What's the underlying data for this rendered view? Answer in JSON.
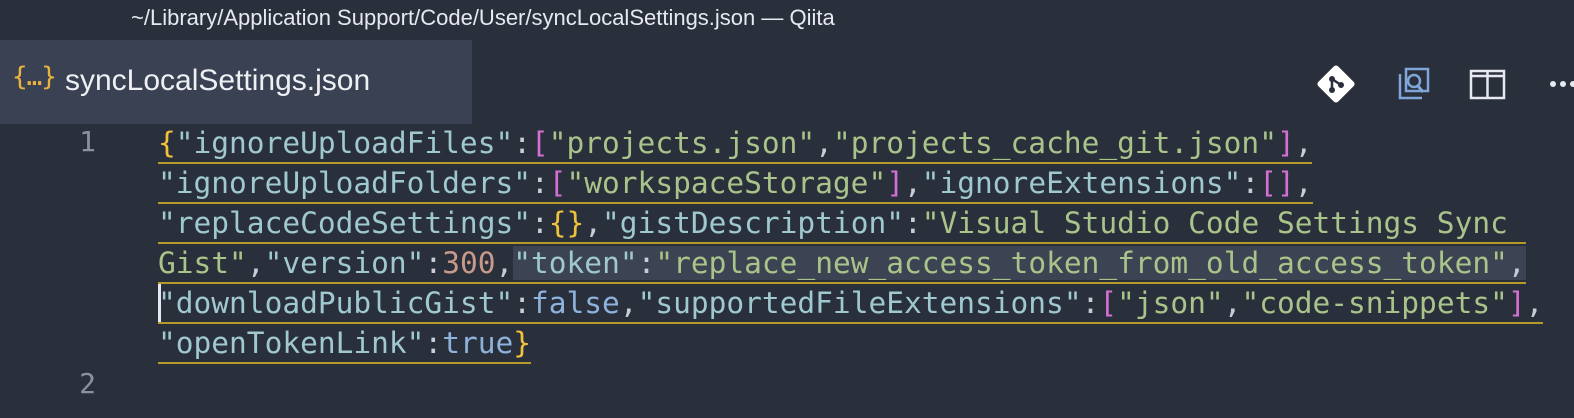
{
  "window": {
    "title": "~/Library/Application Support/Code/User/syncLocalSettings.json — Qiita"
  },
  "tab": {
    "icon": "{…}",
    "label": "syncLocalSettings.json"
  },
  "actions": [
    {
      "name": "git-compare-icon"
    },
    {
      "name": "open-preview-icon"
    },
    {
      "name": "split-editor-icon"
    },
    {
      "name": "more-actions-icon"
    }
  ],
  "gutter": {
    "line1": "1",
    "line2": "2"
  },
  "code": {
    "l1": {
      "a": "{",
      "b": "\"ignoreUploadFiles\"",
      "c": ":",
      "d": "[",
      "e": "\"projects.json\"",
      "f": ",",
      "g": "\"projects_cache_git.json\"",
      "h": "]",
      "i": ","
    },
    "l2": {
      "a": "\"ignoreUploadFolders\"",
      "b": ":",
      "c": "[",
      "d": "\"workspaceStorage\"",
      "e": "]",
      "f": ",",
      "g": "\"ignoreExtensions\"",
      "h": ":",
      "i": "[]",
      "j": ","
    },
    "l3": {
      "a": "\"replaceCodeSettings\"",
      "b": ":",
      "c": "{}",
      "d": ",",
      "e": "\"gistDescription\"",
      "f": ":",
      "g": "\"Visual Studio Code Settings Sync "
    },
    "l4": {
      "a": "Gist\"",
      "b": ",",
      "c": "\"version\"",
      "d": ":",
      "e": "300",
      "f": ",",
      "g": "\"token\"",
      "h": ":",
      "i": "\"replace_new_access_token_from_old_access_token\"",
      "j": ","
    },
    "l5": {
      "a": "\"downloadPublicGist\"",
      "b": ":",
      "c": "false",
      "d": ",",
      "e": "\"supportedFileExtensions\"",
      "f": ":",
      "g": "[",
      "h": "\"json\"",
      "i": ",",
      "j": "\"code-snippets\"",
      "k": "]",
      "l": ","
    },
    "l6": {
      "a": "\"openTokenLink\"",
      "b": ":",
      "c": "true",
      "d": "}"
    }
  },
  "colors": {
    "background": "#2a2f3c",
    "tab_active": "#3a4152",
    "bracket": "#f0c23b",
    "array_bracket": "#d46fd3",
    "key": "#9fc8cf",
    "string": "#a9c48a",
    "number": "#c79a8a",
    "keyword": "#8db2dc",
    "underline": "#b59a2a"
  }
}
